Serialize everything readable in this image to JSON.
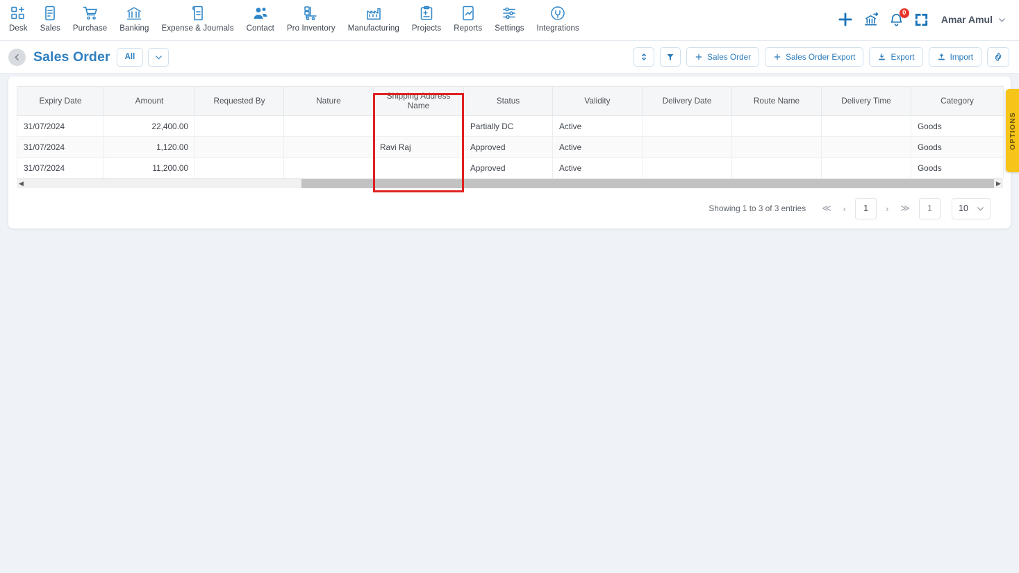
{
  "nav": {
    "items": [
      {
        "label": "Desk",
        "icon": "desk-grid-plus-icon"
      },
      {
        "label": "Sales",
        "icon": "sales-document-icon"
      },
      {
        "label": "Purchase",
        "icon": "purchase-cart-icon"
      },
      {
        "label": "Banking",
        "icon": "banking-bank-icon"
      },
      {
        "label": "Expense & Journals",
        "icon": "expense-journal-icon"
      },
      {
        "label": "Contact",
        "icon": "contact-people-icon"
      },
      {
        "label": "Pro Inventory",
        "icon": "pro-inventory-forklift-icon"
      },
      {
        "label": "Manufacturing",
        "icon": "manufacturing-factory-icon"
      },
      {
        "label": "Projects",
        "icon": "projects-clipboard-icon"
      },
      {
        "label": "Reports",
        "icon": "reports-chart-icon"
      },
      {
        "label": "Settings",
        "icon": "settings-sliders-icon"
      },
      {
        "label": "Integrations",
        "icon": "integrations-plug-icon"
      }
    ],
    "right": {
      "add_icon": "plus-icon",
      "transfer_icon": "bank-transfer-icon",
      "bell_icon": "bell-icon",
      "bell_badge": "0",
      "apps_icon": "apps-grid-icon",
      "user_name": "Amar Amul",
      "user_caret_icon": "chevron-down-icon"
    }
  },
  "subheader": {
    "back_icon": "chevron-left-icon",
    "title": "Sales Order",
    "filter_pill": "All",
    "filter_caret_icon": "chevron-down-icon",
    "toolbar": {
      "sort_icon": "sort-updown-icon",
      "filter_icon": "funnel-filter-icon",
      "new_sales_order": "Sales Order",
      "new_sales_order_export": "Sales Order Export",
      "export": "Export",
      "import": "Import",
      "settings_icon": "gear-icon"
    }
  },
  "table": {
    "columns": [
      "Expiry Date",
      "Amount",
      "Requested By",
      "Nature",
      "Shipping Address Name",
      "Status",
      "Validity",
      "Delivery Date",
      "Route Name",
      "Delivery Time",
      "Category"
    ],
    "rows": [
      {
        "expiry_date": "31/07/2024",
        "amount": "22,400.00",
        "requested_by": "",
        "nature": "",
        "shipping_address_name": "",
        "status": "Partially DC",
        "validity": "Active",
        "delivery_date": "",
        "route_name": "",
        "delivery_time": "",
        "category": "Goods"
      },
      {
        "expiry_date": "31/07/2024",
        "amount": "1,120.00",
        "requested_by": "",
        "nature": "",
        "shipping_address_name": "Ravi Raj",
        "status": "Approved",
        "validity": "Active",
        "delivery_date": "",
        "route_name": "",
        "delivery_time": "",
        "category": "Goods"
      },
      {
        "expiry_date": "31/07/2024",
        "amount": "11,200.00",
        "requested_by": "",
        "nature": "",
        "shipping_address_name": "",
        "status": "Approved",
        "validity": "Active",
        "delivery_date": "",
        "route_name": "",
        "delivery_time": "",
        "category": "Goods"
      }
    ]
  },
  "footer": {
    "showing": "Showing 1 to 3 of 3 entries",
    "first_icon": "double-chevron-left-icon",
    "prev_icon": "chevron-left-icon",
    "current_page": "1",
    "next_icon": "chevron-right-icon",
    "last_icon": "double-chevron-right-icon",
    "goto_page": "1",
    "page_size": "10",
    "page_size_caret_icon": "chevron-down-icon"
  },
  "options_tab": {
    "label": "OPTIONS",
    "color": "#f7c419"
  },
  "annotation": {
    "highlight_color": "#e02020",
    "target_column": "Shipping Address Name"
  },
  "colors": {
    "accent_blue": "#2f7fc0",
    "page_bg": "#eff2f7",
    "card_bg": "#ffffff",
    "header_bg": "#f5f6f7",
    "badge_red": "#e8342a"
  }
}
